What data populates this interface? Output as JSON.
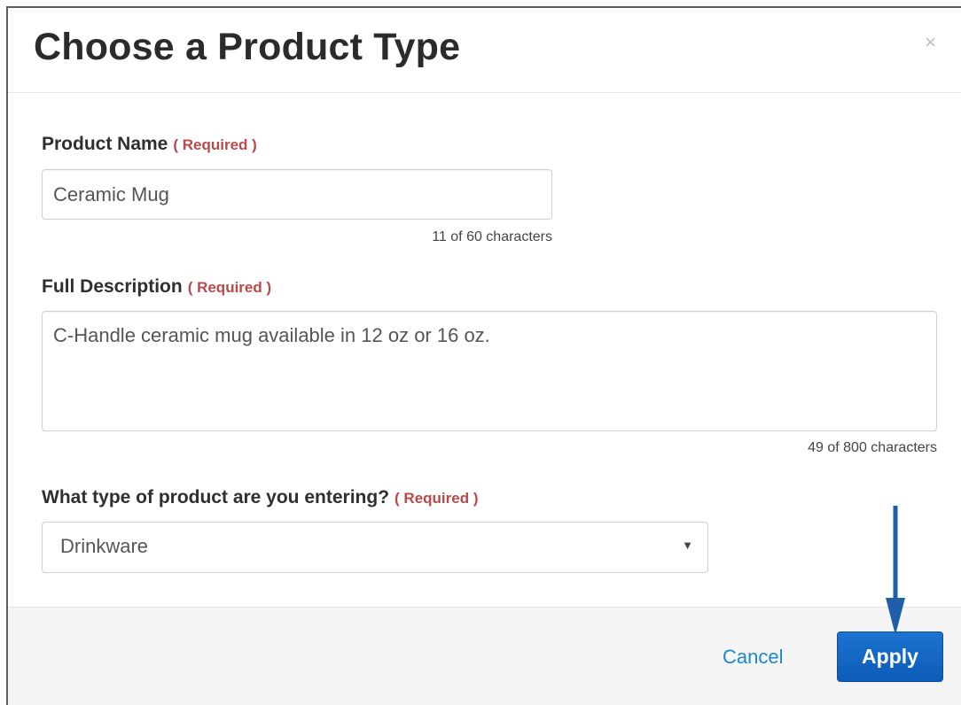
{
  "dialog": {
    "title": "Choose a Product Type",
    "close_symbol": "×"
  },
  "fields": {
    "product_name": {
      "label": "Product Name",
      "required": "( Required )",
      "value": "Ceramic Mug",
      "counter": "11 of 60 characters"
    },
    "description": {
      "label": "Full Description",
      "required": "( Required )",
      "value": "C-Handle ceramic mug available in 12 oz or 16 oz.",
      "counter": "49 of 800 characters"
    },
    "product_type": {
      "label": "What type of product are you entering?",
      "required": "( Required )",
      "selected": "Drinkware",
      "caret": "▼"
    }
  },
  "footer": {
    "cancel_label": "Cancel",
    "apply_label": "Apply"
  },
  "annotation": {
    "arrow_color": "#1f5fa8",
    "icon": "down-arrow-icon"
  },
  "colors": {
    "required": "#b94a48",
    "link": "#1e88c8",
    "primary": "#1066c6"
  }
}
